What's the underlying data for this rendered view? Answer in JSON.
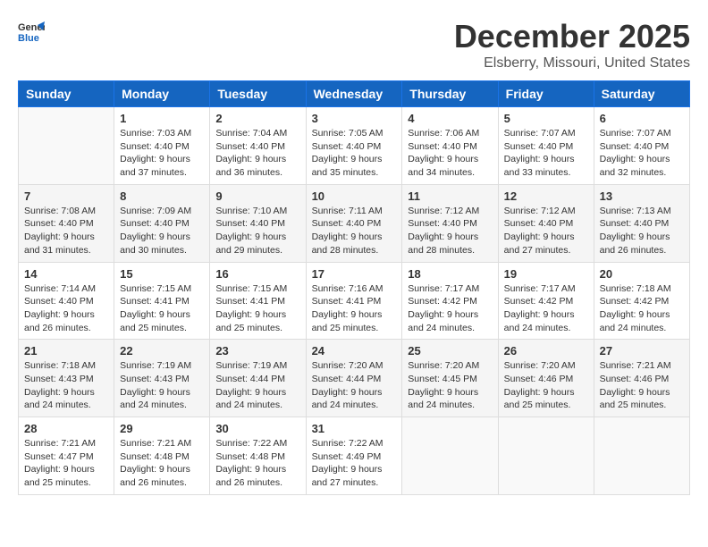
{
  "header": {
    "logo_line1": "General",
    "logo_line2": "Blue",
    "month_title": "December 2025",
    "location": "Elsberry, Missouri, United States"
  },
  "days_of_week": [
    "Sunday",
    "Monday",
    "Tuesday",
    "Wednesday",
    "Thursday",
    "Friday",
    "Saturday"
  ],
  "weeks": [
    [
      {
        "day": "",
        "sunrise": "",
        "sunset": "",
        "daylight": ""
      },
      {
        "day": "1",
        "sunrise": "Sunrise: 7:03 AM",
        "sunset": "Sunset: 4:40 PM",
        "daylight": "Daylight: 9 hours and 37 minutes."
      },
      {
        "day": "2",
        "sunrise": "Sunrise: 7:04 AM",
        "sunset": "Sunset: 4:40 PM",
        "daylight": "Daylight: 9 hours and 36 minutes."
      },
      {
        "day": "3",
        "sunrise": "Sunrise: 7:05 AM",
        "sunset": "Sunset: 4:40 PM",
        "daylight": "Daylight: 9 hours and 35 minutes."
      },
      {
        "day": "4",
        "sunrise": "Sunrise: 7:06 AM",
        "sunset": "Sunset: 4:40 PM",
        "daylight": "Daylight: 9 hours and 34 minutes."
      },
      {
        "day": "5",
        "sunrise": "Sunrise: 7:07 AM",
        "sunset": "Sunset: 4:40 PM",
        "daylight": "Daylight: 9 hours and 33 minutes."
      },
      {
        "day": "6",
        "sunrise": "Sunrise: 7:07 AM",
        "sunset": "Sunset: 4:40 PM",
        "daylight": "Daylight: 9 hours and 32 minutes."
      }
    ],
    [
      {
        "day": "7",
        "sunrise": "Sunrise: 7:08 AM",
        "sunset": "Sunset: 4:40 PM",
        "daylight": "Daylight: 9 hours and 31 minutes."
      },
      {
        "day": "8",
        "sunrise": "Sunrise: 7:09 AM",
        "sunset": "Sunset: 4:40 PM",
        "daylight": "Daylight: 9 hours and 30 minutes."
      },
      {
        "day": "9",
        "sunrise": "Sunrise: 7:10 AM",
        "sunset": "Sunset: 4:40 PM",
        "daylight": "Daylight: 9 hours and 29 minutes."
      },
      {
        "day": "10",
        "sunrise": "Sunrise: 7:11 AM",
        "sunset": "Sunset: 4:40 PM",
        "daylight": "Daylight: 9 hours and 28 minutes."
      },
      {
        "day": "11",
        "sunrise": "Sunrise: 7:12 AM",
        "sunset": "Sunset: 4:40 PM",
        "daylight": "Daylight: 9 hours and 28 minutes."
      },
      {
        "day": "12",
        "sunrise": "Sunrise: 7:12 AM",
        "sunset": "Sunset: 4:40 PM",
        "daylight": "Daylight: 9 hours and 27 minutes."
      },
      {
        "day": "13",
        "sunrise": "Sunrise: 7:13 AM",
        "sunset": "Sunset: 4:40 PM",
        "daylight": "Daylight: 9 hours and 26 minutes."
      }
    ],
    [
      {
        "day": "14",
        "sunrise": "Sunrise: 7:14 AM",
        "sunset": "Sunset: 4:40 PM",
        "daylight": "Daylight: 9 hours and 26 minutes."
      },
      {
        "day": "15",
        "sunrise": "Sunrise: 7:15 AM",
        "sunset": "Sunset: 4:41 PM",
        "daylight": "Daylight: 9 hours and 25 minutes."
      },
      {
        "day": "16",
        "sunrise": "Sunrise: 7:15 AM",
        "sunset": "Sunset: 4:41 PM",
        "daylight": "Daylight: 9 hours and 25 minutes."
      },
      {
        "day": "17",
        "sunrise": "Sunrise: 7:16 AM",
        "sunset": "Sunset: 4:41 PM",
        "daylight": "Daylight: 9 hours and 25 minutes."
      },
      {
        "day": "18",
        "sunrise": "Sunrise: 7:17 AM",
        "sunset": "Sunset: 4:42 PM",
        "daylight": "Daylight: 9 hours and 24 minutes."
      },
      {
        "day": "19",
        "sunrise": "Sunrise: 7:17 AM",
        "sunset": "Sunset: 4:42 PM",
        "daylight": "Daylight: 9 hours and 24 minutes."
      },
      {
        "day": "20",
        "sunrise": "Sunrise: 7:18 AM",
        "sunset": "Sunset: 4:42 PM",
        "daylight": "Daylight: 9 hours and 24 minutes."
      }
    ],
    [
      {
        "day": "21",
        "sunrise": "Sunrise: 7:18 AM",
        "sunset": "Sunset: 4:43 PM",
        "daylight": "Daylight: 9 hours and 24 minutes."
      },
      {
        "day": "22",
        "sunrise": "Sunrise: 7:19 AM",
        "sunset": "Sunset: 4:43 PM",
        "daylight": "Daylight: 9 hours and 24 minutes."
      },
      {
        "day": "23",
        "sunrise": "Sunrise: 7:19 AM",
        "sunset": "Sunset: 4:44 PM",
        "daylight": "Daylight: 9 hours and 24 minutes."
      },
      {
        "day": "24",
        "sunrise": "Sunrise: 7:20 AM",
        "sunset": "Sunset: 4:44 PM",
        "daylight": "Daylight: 9 hours and 24 minutes."
      },
      {
        "day": "25",
        "sunrise": "Sunrise: 7:20 AM",
        "sunset": "Sunset: 4:45 PM",
        "daylight": "Daylight: 9 hours and 24 minutes."
      },
      {
        "day": "26",
        "sunrise": "Sunrise: 7:20 AM",
        "sunset": "Sunset: 4:46 PM",
        "daylight": "Daylight: 9 hours and 25 minutes."
      },
      {
        "day": "27",
        "sunrise": "Sunrise: 7:21 AM",
        "sunset": "Sunset: 4:46 PM",
        "daylight": "Daylight: 9 hours and 25 minutes."
      }
    ],
    [
      {
        "day": "28",
        "sunrise": "Sunrise: 7:21 AM",
        "sunset": "Sunset: 4:47 PM",
        "daylight": "Daylight: 9 hours and 25 minutes."
      },
      {
        "day": "29",
        "sunrise": "Sunrise: 7:21 AM",
        "sunset": "Sunset: 4:48 PM",
        "daylight": "Daylight: 9 hours and 26 minutes."
      },
      {
        "day": "30",
        "sunrise": "Sunrise: 7:22 AM",
        "sunset": "Sunset: 4:48 PM",
        "daylight": "Daylight: 9 hours and 26 minutes."
      },
      {
        "day": "31",
        "sunrise": "Sunrise: 7:22 AM",
        "sunset": "Sunset: 4:49 PM",
        "daylight": "Daylight: 9 hours and 27 minutes."
      },
      {
        "day": "",
        "sunrise": "",
        "sunset": "",
        "daylight": ""
      },
      {
        "day": "",
        "sunrise": "",
        "sunset": "",
        "daylight": ""
      },
      {
        "day": "",
        "sunrise": "",
        "sunset": "",
        "daylight": ""
      }
    ]
  ]
}
